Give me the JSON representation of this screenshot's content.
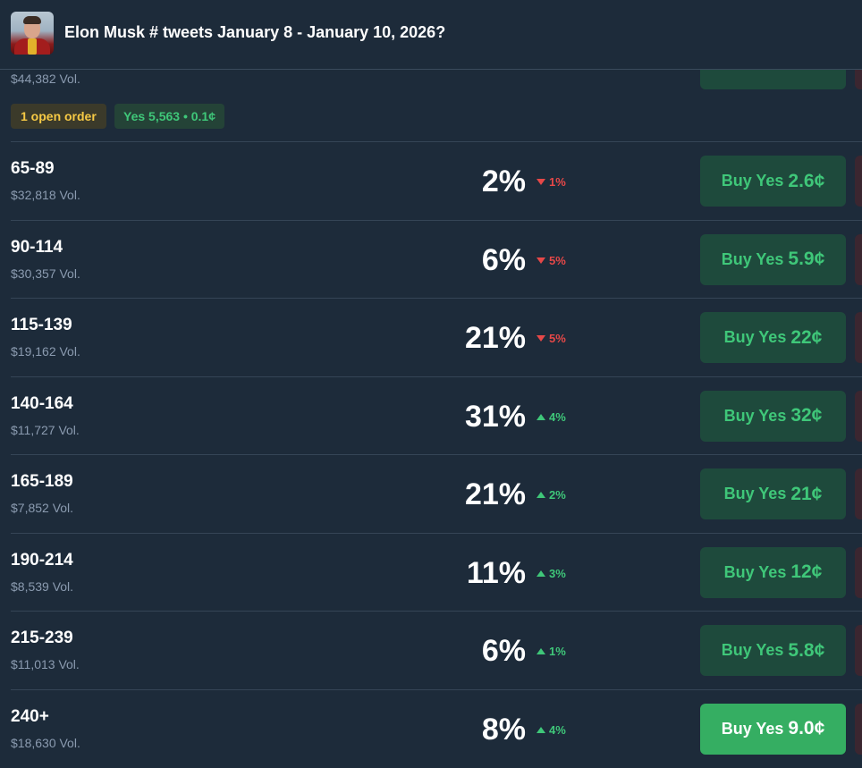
{
  "header": {
    "title": "Elon Musk # tweets January 8 - January 10, 2026?",
    "avatar": "elon-musk-avatar"
  },
  "partial_row": {
    "volume": "$44,382 Vol.",
    "badges": {
      "open_order": "1 open order",
      "yes_position": "Yes 5,563 • 0.1¢"
    }
  },
  "outcomes": [
    {
      "label": "65-89",
      "volume": "$32,818 Vol.",
      "probability": "2%",
      "change": "1%",
      "direction": "down",
      "buy_label": "Buy Yes",
      "price": "2.6¢"
    },
    {
      "label": "90-114",
      "volume": "$30,357 Vol.",
      "probability": "6%",
      "change": "5%",
      "direction": "down",
      "buy_label": "Buy Yes",
      "price": "5.9¢"
    },
    {
      "label": "115-139",
      "volume": "$19,162 Vol.",
      "probability": "21%",
      "change": "5%",
      "direction": "down",
      "buy_label": "Buy Yes",
      "price": "22¢"
    },
    {
      "label": "140-164",
      "volume": "$11,727 Vol.",
      "probability": "31%",
      "change": "4%",
      "direction": "up",
      "buy_label": "Buy Yes",
      "price": "32¢"
    },
    {
      "label": "165-189",
      "volume": "$7,852 Vol.",
      "probability": "21%",
      "change": "2%",
      "direction": "up",
      "buy_label": "Buy Yes",
      "price": "21¢"
    },
    {
      "label": "190-214",
      "volume": "$8,539 Vol.",
      "probability": "11%",
      "change": "3%",
      "direction": "up",
      "buy_label": "Buy Yes",
      "price": "12¢"
    },
    {
      "label": "215-239",
      "volume": "$11,013 Vol.",
      "probability": "6%",
      "change": "1%",
      "direction": "up",
      "buy_label": "Buy Yes",
      "price": "5.8¢"
    },
    {
      "label": "240+",
      "volume": "$18,630 Vol.",
      "probability": "8%",
      "change": "4%",
      "direction": "up",
      "buy_label": "Buy Yes",
      "price": "9.0¢",
      "active": true
    }
  ],
  "colors": {
    "background": "#1d2b3a",
    "yes_green": "#3fc779",
    "down_red": "#e64848",
    "active_button": "#35ae62"
  }
}
